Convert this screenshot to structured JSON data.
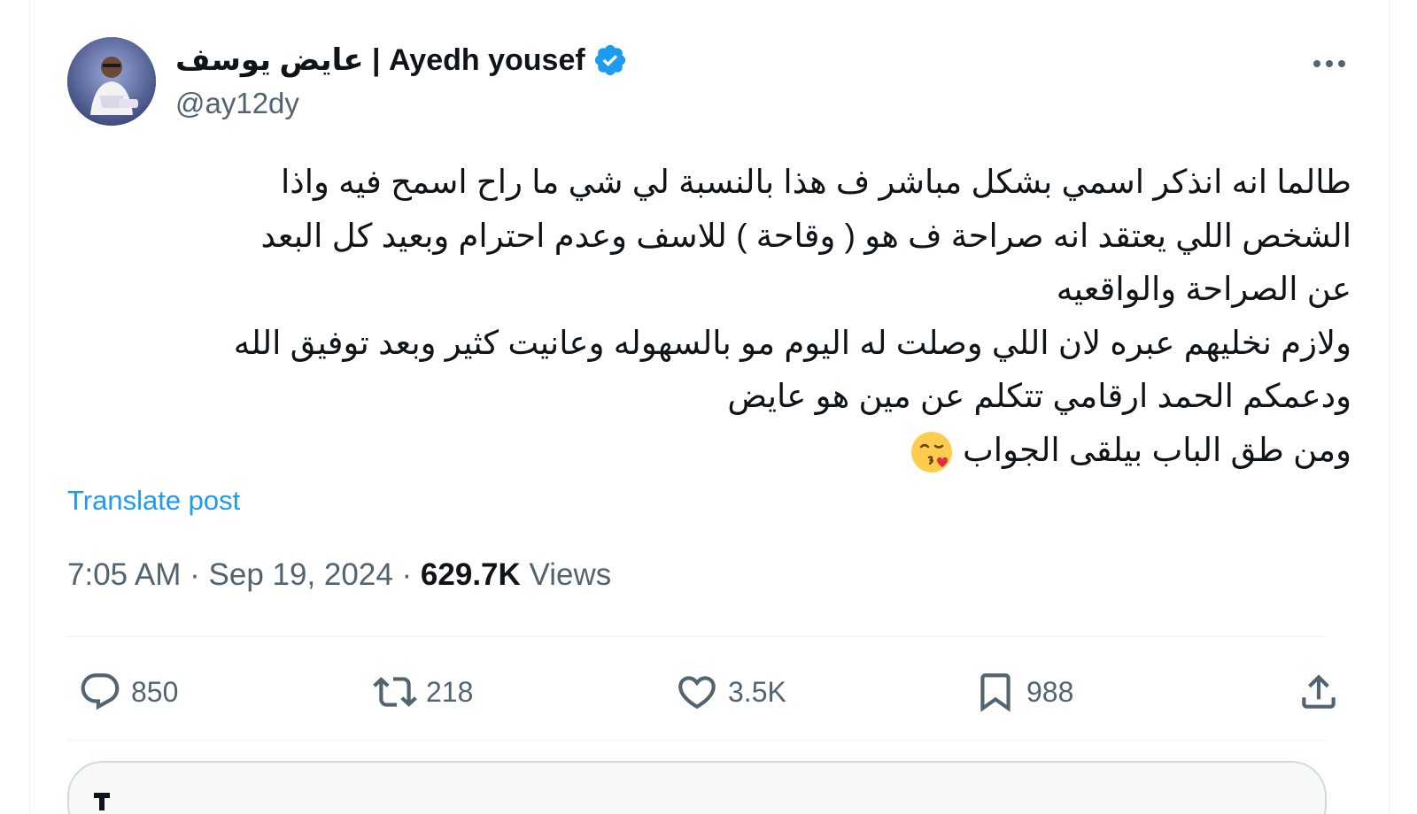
{
  "author": {
    "display_name": "عايض يوسف | Ayedh yousef",
    "handle": "@ay12dy",
    "verified": true,
    "avatar_icon": "profile-photo"
  },
  "post": {
    "lines": [
      "طالما انه انذكر اسمي بشكل مباشر ف هذا بالنسبة لي شي ما راح اسمح فيه واذا",
      "الشخص اللي يعتقد انه صراحة ف هو ( وقاحة ) للاسف وعدم احترام وبعيد كل البعد",
      "عن الصراحة والواقعيه",
      "ولازم نخليهم عبره لان اللي وصلت له اليوم مو بالسهوله وعانيت كثير وبعد توفيق الله",
      "ودعمكم الحمد ارقامي تتكلم عن مين هو عايض",
      "ومن طق الباب بيلقى الجواب"
    ],
    "emoji": "kissing-face-with-heart-emoji",
    "translate_label": "Translate post"
  },
  "meta": {
    "time": "7:05 AM",
    "separator": "·",
    "date": "Sep 19, 2024",
    "views_count": "629.7K",
    "views_label": "Views"
  },
  "actions": {
    "reply_count": "850",
    "repost_count": "218",
    "like_count": "3.5K",
    "bookmark_count": "988"
  },
  "colors": {
    "accent": "#1d9bf0",
    "text_primary": "#0f1419",
    "text_secondary": "#536471",
    "divider": "#eff3f4"
  }
}
